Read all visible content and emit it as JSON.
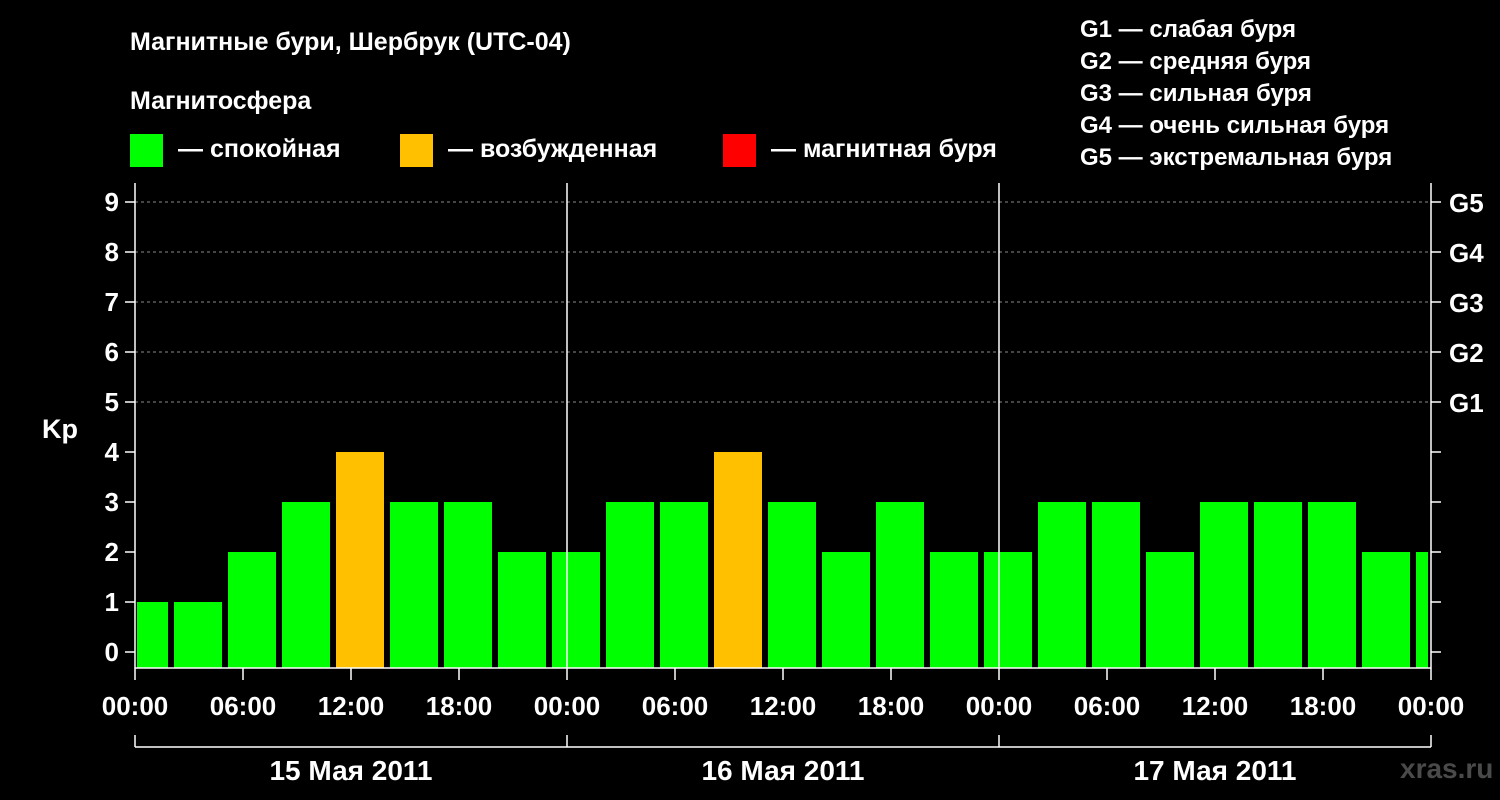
{
  "chart_data": {
    "type": "bar",
    "title": "Магнитные бури, Шербрук (UTC-04)",
    "legend": {
      "heading": "Магнитосфера",
      "items": [
        {
          "label": "— спокойная",
          "color": "#00ff00"
        },
        {
          "label": "— возбужденная",
          "color": "#ffc000"
        },
        {
          "label": "— магнитная буря",
          "color": "#ff0000"
        }
      ]
    },
    "storm_scale": [
      "G1 — слабая буря",
      "G2 — средняя буря",
      "G3 — сильная буря",
      "G4 — очень сильная буря",
      "G5 — экстремальная буря"
    ],
    "ylabel": "Kp",
    "ylim": [
      0,
      9
    ],
    "y_ticks": [
      "0",
      "1",
      "2",
      "3",
      "4",
      "5",
      "6",
      "7",
      "8",
      "9"
    ],
    "right_axis_labels": [
      {
        "kp": 5,
        "label": "G1"
      },
      {
        "kp": 6,
        "label": "G2"
      },
      {
        "kp": 7,
        "label": "G3"
      },
      {
        "kp": 8,
        "label": "G4"
      },
      {
        "kp": 9,
        "label": "G5"
      }
    ],
    "x_ticks": [
      "00:00",
      "06:00",
      "12:00",
      "18:00",
      "00:00",
      "06:00",
      "12:00",
      "18:00",
      "00:00",
      "06:00",
      "12:00",
      "18:00",
      "00:00"
    ],
    "days": [
      "15 Мая 2011",
      "16 Мая 2011",
      "17 Мая 2011"
    ],
    "grid": "dashed horizontal lines at G1–G5 levels",
    "bars": [
      {
        "start": "2011-05-15 00:00",
        "end": "2011-05-15 02:00",
        "kp": 1,
        "state": "calm"
      },
      {
        "start": "2011-05-15 02:00",
        "end": "2011-05-15 05:00",
        "kp": 1,
        "state": "calm"
      },
      {
        "start": "2011-05-15 05:00",
        "end": "2011-05-15 08:00",
        "kp": 2,
        "state": "calm"
      },
      {
        "start": "2011-05-15 08:00",
        "end": "2011-05-15 11:00",
        "kp": 3,
        "state": "calm"
      },
      {
        "start": "2011-05-15 11:00",
        "end": "2011-05-15 14:00",
        "kp": 4,
        "state": "active"
      },
      {
        "start": "2011-05-15 14:00",
        "end": "2011-05-15 17:00",
        "kp": 3,
        "state": "calm"
      },
      {
        "start": "2011-05-15 17:00",
        "end": "2011-05-15 20:00",
        "kp": 3,
        "state": "calm"
      },
      {
        "start": "2011-05-15 20:00",
        "end": "2011-05-15 23:00",
        "kp": 2,
        "state": "calm"
      },
      {
        "start": "2011-05-15 23:00",
        "end": "2011-05-16 02:00",
        "kp": 2,
        "state": "calm"
      },
      {
        "start": "2011-05-16 02:00",
        "end": "2011-05-16 05:00",
        "kp": 3,
        "state": "calm"
      },
      {
        "start": "2011-05-16 05:00",
        "end": "2011-05-16 08:00",
        "kp": 3,
        "state": "calm"
      },
      {
        "start": "2011-05-16 08:00",
        "end": "2011-05-16 11:00",
        "kp": 4,
        "state": "active"
      },
      {
        "start": "2011-05-16 11:00",
        "end": "2011-05-16 14:00",
        "kp": 3,
        "state": "calm"
      },
      {
        "start": "2011-05-16 14:00",
        "end": "2011-05-16 17:00",
        "kp": 2,
        "state": "calm"
      },
      {
        "start": "2011-05-16 17:00",
        "end": "2011-05-16 20:00",
        "kp": 3,
        "state": "calm"
      },
      {
        "start": "2011-05-16 20:00",
        "end": "2011-05-16 23:00",
        "kp": 2,
        "state": "calm"
      },
      {
        "start": "2011-05-16 23:00",
        "end": "2011-05-17 02:00",
        "kp": 2,
        "state": "calm"
      },
      {
        "start": "2011-05-17 02:00",
        "end": "2011-05-17 05:00",
        "kp": 3,
        "state": "calm"
      },
      {
        "start": "2011-05-17 05:00",
        "end": "2011-05-17 08:00",
        "kp": 3,
        "state": "calm"
      },
      {
        "start": "2011-05-17 08:00",
        "end": "2011-05-17 11:00",
        "kp": 2,
        "state": "calm"
      },
      {
        "start": "2011-05-17 11:00",
        "end": "2011-05-17 14:00",
        "kp": 3,
        "state": "calm"
      },
      {
        "start": "2011-05-17 14:00",
        "end": "2011-05-17 17:00",
        "kp": 3,
        "state": "calm"
      },
      {
        "start": "2011-05-17 17:00",
        "end": "2011-05-17 20:00",
        "kp": 3,
        "state": "calm"
      },
      {
        "start": "2011-05-17 20:00",
        "end": "2011-05-17 23:00",
        "kp": 2,
        "state": "calm"
      },
      {
        "start": "2011-05-17 23:00",
        "end": "2011-05-18 00:00",
        "kp": 2,
        "state": "calm"
      }
    ],
    "state_colors": {
      "calm": "#00ff00",
      "active": "#ffc000",
      "storm": "#ff0000"
    }
  },
  "watermark": "xras.ru"
}
